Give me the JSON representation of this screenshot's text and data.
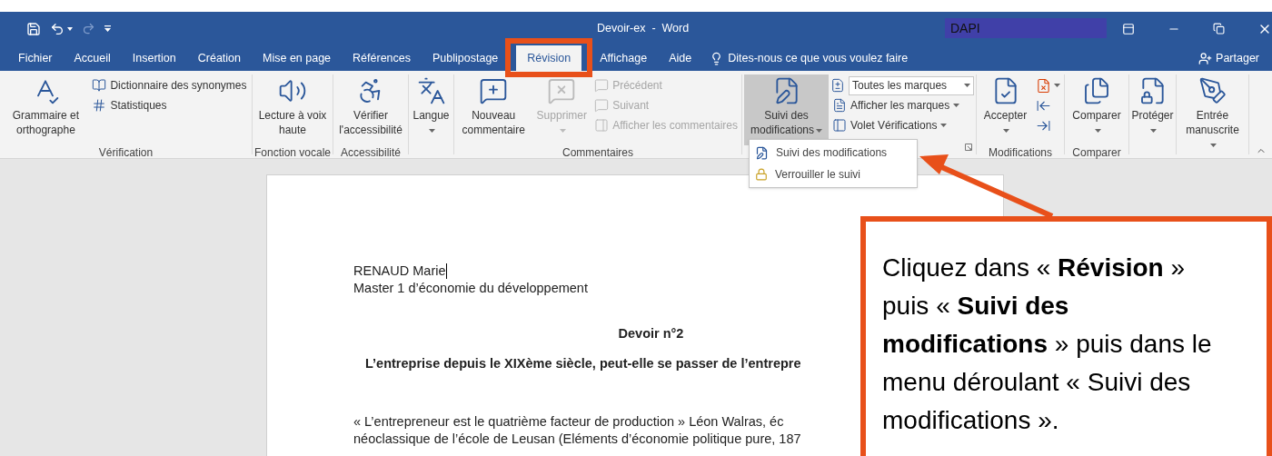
{
  "window": {
    "title": "Devoir-ex  -  Word",
    "account": "DAPI"
  },
  "tabs": [
    {
      "label": "Fichier",
      "selected": false
    },
    {
      "label": "Accueil",
      "selected": false
    },
    {
      "label": "Insertion",
      "selected": false
    },
    {
      "label": "Création",
      "selected": false
    },
    {
      "label": "Mise en page",
      "selected": false
    },
    {
      "label": "Références",
      "selected": false
    },
    {
      "label": "Publipostage",
      "selected": false
    },
    {
      "label": "Révision",
      "selected": true
    },
    {
      "label": "Affichage",
      "selected": false
    },
    {
      "label": "Aide",
      "selected": false
    }
  ],
  "tell_me": {
    "placeholder": "Dites-nous ce que vous voulez faire"
  },
  "share": "Partager",
  "ribbon": [
    {
      "label": "Vérification",
      "items": [
        {
          "kind": "large",
          "label": "Grammaire et orthographe",
          "disabled": false,
          "dropdown": false
        },
        {
          "kind": "small",
          "label": "Dictionnaire des synonymes",
          "disabled": false,
          "dropdown": false
        },
        {
          "kind": "small",
          "label": "Statistiques",
          "disabled": false,
          "dropdown": false
        }
      ]
    },
    {
      "label": "Fonction vocale",
      "items": [
        {
          "kind": "large",
          "label": "Lecture à voix haute",
          "disabled": false,
          "dropdown": false
        }
      ]
    },
    {
      "label": "Accessibilité",
      "items": [
        {
          "kind": "large",
          "label": "Vérifier l'accessibilité",
          "disabled": false,
          "dropdown": false
        }
      ]
    },
    {
      "items": [
        {
          "kind": "large",
          "label": "Langue",
          "disabled": false,
          "dropdown": true
        }
      ]
    },
    {
      "label": "Commentaires",
      "items": [
        {
          "kind": "large",
          "label": "Nouveau commentaire",
          "disabled": false,
          "dropdown": false
        },
        {
          "kind": "large",
          "label": "Supprimer",
          "disabled": true,
          "dropdown": true
        },
        {
          "kind": "small",
          "label": "Précédent",
          "disabled": true,
          "dropdown": false
        },
        {
          "kind": "small",
          "label": "Suivant",
          "disabled": true,
          "dropdown": false
        },
        {
          "kind": "small",
          "label": "Afficher les commentaires",
          "disabled": true,
          "dropdown": false
        }
      ]
    },
    {
      "launcher": true,
      "items": [
        {
          "kind": "large",
          "label": "Suivi des modifications",
          "disabled": false,
          "dropdown": true,
          "pressed": true
        },
        {
          "kind": "field",
          "label": "Toutes les marques",
          "disabled": false,
          "dropdown": true
        },
        {
          "kind": "small",
          "label": "Afficher les marques",
          "disabled": false,
          "dropdown": true
        },
        {
          "kind": "small",
          "label": "Volet Vérifications",
          "disabled": false,
          "dropdown": true
        }
      ]
    },
    {
      "label": "Modifications",
      "items": [
        {
          "kind": "large",
          "label": "Accepter",
          "disabled": false,
          "dropdown": true
        },
        {
          "kind": "icon",
          "disabled": false,
          "dropdown": true
        },
        {
          "kind": "icon",
          "disabled": false,
          "dropdown": false
        },
        {
          "kind": "icon",
          "disabled": false,
          "dropdown": false
        }
      ]
    },
    {
      "label": "Comparer",
      "items": [
        {
          "kind": "large",
          "label": "Comparer",
          "disabled": false,
          "dropdown": true
        }
      ]
    },
    {
      "items": [
        {
          "kind": "large",
          "label": "Protéger",
          "disabled": false,
          "dropdown": true
        }
      ]
    },
    {
      "items": [
        {
          "kind": "large",
          "label": "Entrée manuscrite",
          "disabled": false,
          "dropdown": true
        }
      ]
    }
  ],
  "menu": [
    {
      "label": "Suivi des modifications"
    },
    {
      "label": "Verrouiller le suivi"
    }
  ],
  "document": {
    "author": "RENAUD Marie",
    "course": "Master 1 d’économie du développement",
    "heading": "Devoir n°2",
    "subject": "L’entreprise depuis le XIXème siècle, peut-elle se passer de l’entrepre",
    "paragraph": [
      "« L’entrepreneur est le quatrième facteur de production » Léon Walras, éc",
      "néoclassique de l’école de Leusan (Eléments d’économie politique pure, 187"
    ]
  },
  "callout": "Cliquez dans « **Révision** » puis « **Suivi des modifications** » puis dans le menu déroulant « Suivi des modifications »."
}
